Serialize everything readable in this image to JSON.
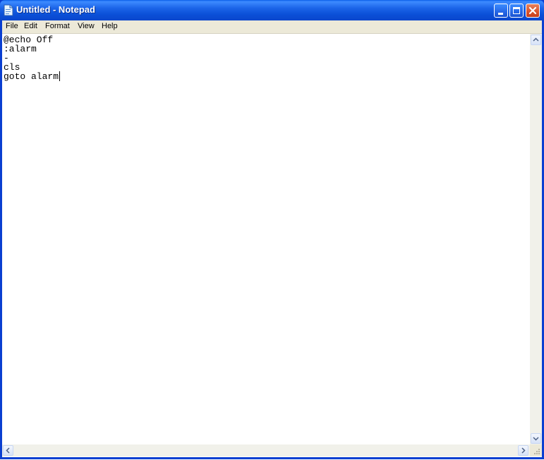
{
  "window": {
    "title": "Untitled - Notepad",
    "icon": "notepad-icon",
    "controls": [
      "minimize-icon",
      "maximize-icon",
      "close-icon"
    ]
  },
  "menu": {
    "items": [
      {
        "label": "File"
      },
      {
        "label": "Edit"
      },
      {
        "label": "Format"
      },
      {
        "label": "View"
      },
      {
        "label": "Help"
      }
    ]
  },
  "editor": {
    "lines": [
      "@echo Off",
      ":alarm",
      "-",
      "cls",
      "goto alarm"
    ]
  },
  "colors": {
    "titlebar": "#0a5fe8",
    "close_button": "#d9542b",
    "menubar": "#ece9d8",
    "scrollbar_track": "#f1f1ea"
  }
}
